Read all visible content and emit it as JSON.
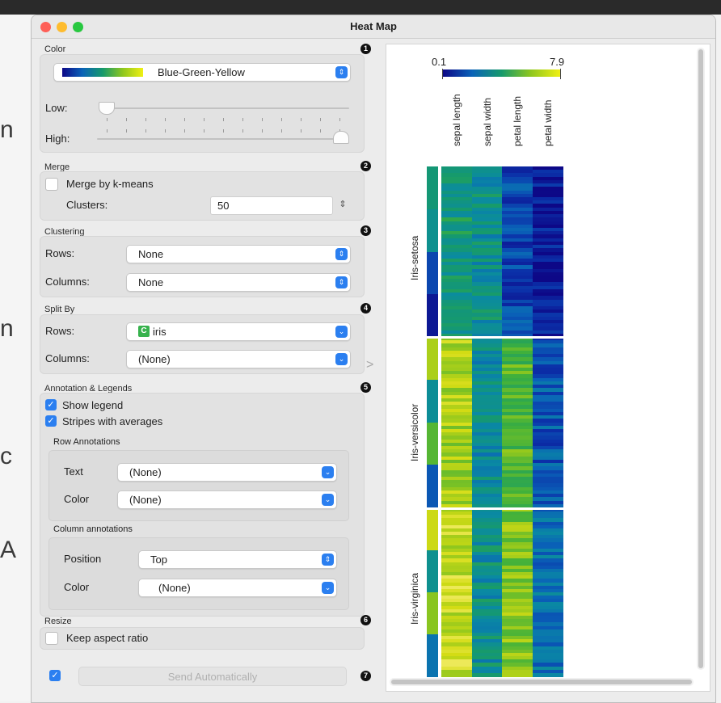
{
  "window": {
    "title": "Heat Map"
  },
  "color_box": {
    "header": "Color",
    "badge": "1",
    "palette": "Blue-Green-Yellow",
    "low_label": "Low:",
    "high_label": "High:",
    "low_value": 0.0,
    "high_value": 1.0
  },
  "merge_box": {
    "header": "Merge",
    "badge": "2",
    "merge_label": "Merge by k-means",
    "merge_checked": false,
    "clusters_label": "Clusters:",
    "clusters_value": "50"
  },
  "clustering_box": {
    "header": "Clustering",
    "badge": "3",
    "rows_label": "Rows:",
    "rows_value": "None",
    "columns_label": "Columns:",
    "columns_value": "None"
  },
  "split_box": {
    "header": "Split By",
    "badge": "4",
    "rows_label": "Rows:",
    "rows_badge": "C",
    "rows_value": "iris",
    "columns_label": "Columns:",
    "columns_value": "(None)"
  },
  "annotation_box": {
    "header": "Annotation & Legends",
    "badge": "5",
    "show_legend": "Show legend",
    "show_legend_checked": true,
    "stripes": "Stripes with averages",
    "stripes_checked": true,
    "row_header": "Row Annotations",
    "row_text_label": "Text",
    "row_text_value": "(None)",
    "row_color_label": "Color",
    "row_color_value": "(None)",
    "col_header": "Column annotations",
    "col_position_label": "Position",
    "col_position_value": "Top",
    "col_color_label": "Color",
    "col_color_value": "(None)"
  },
  "resize_box": {
    "header": "Resize",
    "badge": "6",
    "keep_aspect": "Keep aspect ratio",
    "keep_aspect_checked": false
  },
  "footer": {
    "send_auto": "Send Automatically",
    "send_checked": true,
    "badge": "7"
  },
  "collapse_arrow": ">",
  "colors": {
    "accent": "#2b7ff0",
    "palette": [
      "#0d0887",
      "#0b2fa8",
      "#0a63b8",
      "#0a8aa2",
      "#169a6c",
      "#3fb03c",
      "#8fc71e",
      "#d4dc14",
      "#f6ee74"
    ]
  },
  "chart_data": {
    "type": "heatmap",
    "legend": {
      "min": "0.1",
      "max": "7.9"
    },
    "columns": [
      "sepal length",
      "sepal width",
      "petal length",
      "petal width"
    ],
    "row_groups": [
      {
        "name": "Iris-setosa",
        "rows": 50,
        "averages": [
          0.48,
          0.42,
          0.18,
          0.05
        ]
      },
      {
        "name": "Iris-versicolor",
        "rows": 50,
        "averages": [
          0.8,
          0.4,
          0.66,
          0.22
        ]
      },
      {
        "name": "Iris-virginica",
        "rows": 50,
        "averages": [
          0.86,
          0.42,
          0.74,
          0.3
        ]
      }
    ]
  }
}
